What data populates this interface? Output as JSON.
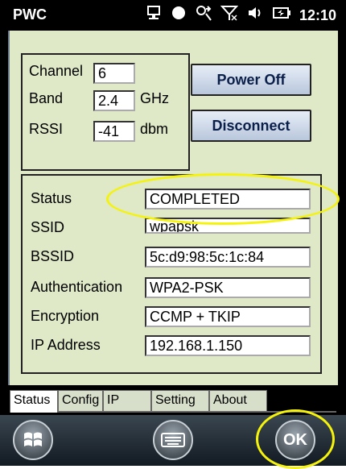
{
  "statusbar": {
    "app_title": "PWC",
    "time": "12:10",
    "icons": [
      "connection-icon",
      "record-icon",
      "network-icon",
      "signal-off-icon",
      "volume-icon",
      "battery-icon"
    ]
  },
  "radio": {
    "channel_label": "Channel",
    "channel_value": "6",
    "band_label": "Band",
    "band_value": "2.4",
    "band_unit": "GHz",
    "rssi_label": "RSSI",
    "rssi_value": "-41",
    "rssi_unit": "dbm"
  },
  "buttons": {
    "power_off": "Power Off",
    "disconnect": "Disconnect"
  },
  "connection": {
    "status_label": "Status",
    "status_value": "COMPLETED",
    "ssid_label": "SSID",
    "ssid_value": "wpapsk",
    "bssid_label": "BSSID",
    "bssid_value": "5c:d9:98:5c:1c:84",
    "auth_label": "Authentication",
    "auth_value": "WPA2-PSK",
    "enc_label": "Encryption",
    "enc_value": "CCMP + TKIP",
    "ip_label": "IP Address",
    "ip_value": "192.168.1.150"
  },
  "tabs": [
    "Status",
    "Config",
    "IP",
    "Setting",
    "About"
  ],
  "active_tab": "Status",
  "softkeys": {
    "ok": "OK",
    "start_icon": "windows-start-icon",
    "keyboard_icon": "keyboard-icon"
  },
  "colors": {
    "panel": "#dfe9c8",
    "highlight": "#f5f20c",
    "button_text": "#0b1f4b"
  }
}
